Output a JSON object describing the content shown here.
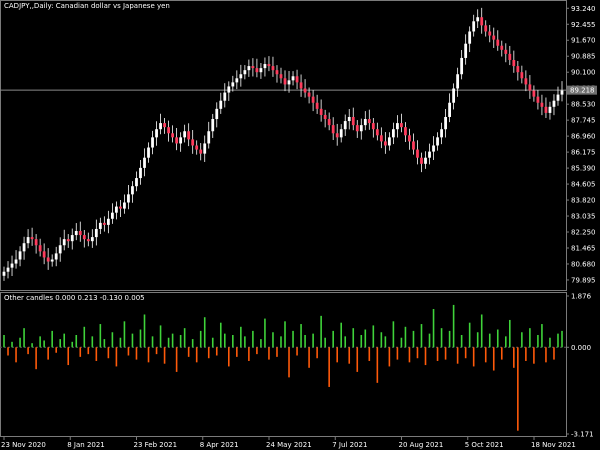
{
  "window": {
    "title": "CADJPY,,Daily:  Canadian dollar vs Japanese yen"
  },
  "indicator": {
    "title": "Other candles 0.000 0.213 -0.130 0.005"
  },
  "price_axis": {
    "ticks": [
      "93.240",
      "92.455",
      "91.670",
      "90.885",
      "90.100",
      "89.315",
      "88.530",
      "87.745",
      "86.960",
      "86.175",
      "85.390",
      "84.605",
      "83.820",
      "83.035",
      "82.250",
      "81.465",
      "80.680",
      "79.895"
    ],
    "current_price": "89.218"
  },
  "indicator_axis": {
    "ticks": [
      "1.876",
      "0.000",
      "-3.171"
    ]
  },
  "time_axis": {
    "ticks": [
      "23 Nov 2020",
      "8 Jan 2021",
      "23 Feb 2021",
      "8 Apr 2021",
      "24 May 2021",
      "7 Jul 2021",
      "20 Aug 2021",
      "5 Oct 2021",
      "18 Nov 2021"
    ]
  },
  "colors": {
    "background": "#000000",
    "grid_line": "#5a5a5a",
    "bull_candle": "#ffffff",
    "bear_candle": "#ff3b5c",
    "wick": "#ffffff",
    "positive_bar": "#3fd33a",
    "negative_bar": "#ff5a0a",
    "axis_text": "#ffffff"
  },
  "chart_data": [
    {
      "type": "candlestick",
      "title": "CADJPY,,Daily:  Canadian dollar vs Japanese yen",
      "ylim": [
        79.5,
        93.45
      ],
      "x_range": [
        "23 Nov 2020",
        "2 Dec 2021"
      ],
      "series": [
        {
          "close": [
            80.3,
            80.5,
            80.7,
            80.9,
            81.3,
            81.7,
            82.0,
            81.9,
            81.6,
            81.3,
            81.0,
            80.8,
            80.9,
            81.2,
            81.6,
            81.9,
            81.8,
            82.1,
            82.3,
            82.1,
            81.9,
            81.8,
            82.0,
            82.4,
            82.7,
            82.6,
            82.9,
            83.2,
            83.5,
            83.4,
            83.7,
            84.1,
            84.5,
            84.9,
            85.4,
            85.9,
            86.4,
            86.9,
            87.3,
            87.6,
            87.4,
            87.1,
            86.9,
            86.6,
            86.9,
            87.2,
            86.8,
            86.5,
            86.3,
            86.1,
            86.6,
            87.2,
            87.8,
            88.3,
            88.7,
            89.1,
            89.4,
            89.6,
            89.8,
            90.0,
            90.2,
            90.4,
            90.3,
            90.1,
            90.3,
            90.5,
            90.4,
            90.2,
            90.0,
            89.8,
            89.5,
            89.7,
            89.9,
            89.6,
            89.3,
            89.1,
            88.9,
            88.6,
            88.3,
            88.0,
            87.8,
            87.5,
            87.1,
            86.9,
            87.3,
            87.7,
            87.9,
            87.5,
            87.2,
            87.5,
            87.8,
            87.6,
            87.3,
            87.0,
            86.7,
            86.5,
            86.9,
            87.3,
            87.6,
            87.4,
            87.0,
            86.7,
            86.3,
            85.9,
            85.6,
            85.9,
            86.2,
            86.5,
            86.9,
            87.3,
            87.9,
            88.6,
            89.3,
            90.0,
            90.8,
            91.5,
            92.1,
            92.6,
            92.8,
            92.4,
            92.1,
            91.9,
            91.7,
            91.4,
            91.2,
            91.0,
            90.7,
            90.4,
            90.1,
            89.8,
            89.5,
            89.2,
            88.9,
            88.6,
            88.4,
            88.1,
            88.4,
            88.7,
            89.0,
            89.2
          ]
        }
      ]
    },
    {
      "type": "bar",
      "title": "Other candles 0.000 0.213 -0.130 0.005",
      "ylim": [
        -3.171,
        1.876
      ],
      "series": [
        {
          "name": "Other candles",
          "values": [
            0.45,
            -0.3,
            0.2,
            -0.55,
            0.35,
            0.7,
            -0.25,
            0.15,
            -0.8,
            0.4,
            0.25,
            -0.45,
            0.6,
            -0.2,
            0.3,
            0.5,
            -0.65,
            0.2,
            0.45,
            -0.35,
            0.75,
            -0.25,
            0.4,
            -0.5,
            0.85,
            0.3,
            -0.4,
            0.55,
            -0.7,
            0.35,
            0.95,
            -0.3,
            0.5,
            -0.45,
            0.65,
            1.2,
            -0.55,
            0.4,
            -0.25,
            0.8,
            -0.6,
            0.35,
            0.5,
            -0.9,
            0.45,
            0.7,
            -0.35,
            0.3,
            -0.55,
            0.6,
            1.1,
            -0.4,
            0.35,
            -0.3,
            0.9,
            0.5,
            -0.7,
            0.45,
            -0.35,
            0.75,
            0.4,
            -0.5,
            0.6,
            -0.25,
            0.3,
            1.05,
            -0.45,
            0.55,
            -0.35,
            0.4,
            0.95,
            -1.1,
            0.6,
            -0.3,
            0.85,
            0.45,
            -0.75,
            0.5,
            -0.4,
            1.15,
            0.35,
            -1.45,
            0.6,
            -0.55,
            0.9,
            0.4,
            -0.6,
            0.7,
            -0.9,
            0.45,
            0.65,
            -0.5,
            0.8,
            -1.3,
            0.55,
            0.4,
            -0.7,
            0.95,
            -0.45,
            0.35,
            0.75,
            -0.55,
            0.6,
            -0.4,
            0.85,
            -0.65,
            0.5,
            1.4,
            -0.5,
            0.7,
            -0.45,
            0.6,
            1.55,
            -0.6,
            0.45,
            -0.4,
            0.9,
            -0.7,
            0.55,
            1.2,
            -0.55,
            0.5,
            -0.85,
            0.65,
            -0.45,
            0.4,
            1.0,
            -0.75,
            -3.05,
            0.55,
            -0.5,
            0.7,
            -0.6,
            0.45,
            0.85,
            -0.55,
            0.35,
            -0.45,
            0.5,
            0.6
          ]
        }
      ]
    }
  ]
}
